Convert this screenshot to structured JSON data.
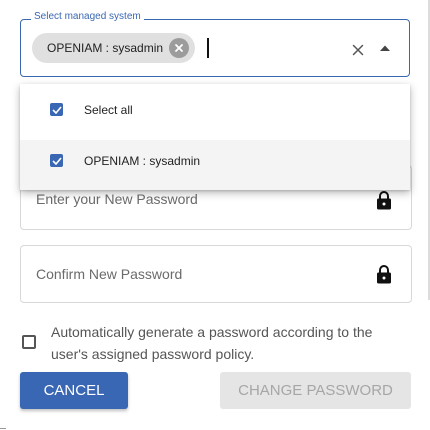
{
  "managed_system": {
    "legend": "Select managed system",
    "chip_label": "OPENIAM : sysadmin",
    "icons": {
      "chip_delete": "cancel-circle-icon",
      "clear": "close-icon",
      "toggle": "arrow-up-icon"
    }
  },
  "dropdown": {
    "options": [
      {
        "label": "Select all",
        "checked": true
      },
      {
        "label": "OPENIAM : sysadmin",
        "checked": true
      }
    ]
  },
  "new_password": {
    "placeholder": "Enter your New Password",
    "icon": "lock-icon"
  },
  "confirm_password": {
    "placeholder": "Confirm New Password",
    "icon": "lock-icon"
  },
  "auto_generate": {
    "label": "Automatically generate a password according to the user's assigned password policy.",
    "checked": false
  },
  "buttons": {
    "cancel": "CANCEL",
    "change_password": "CHANGE PASSWORD"
  },
  "colors": {
    "accent": "#3a67b3",
    "disabled_bg": "#e5e5e5",
    "disabled_text": "#a6a6a6"
  }
}
